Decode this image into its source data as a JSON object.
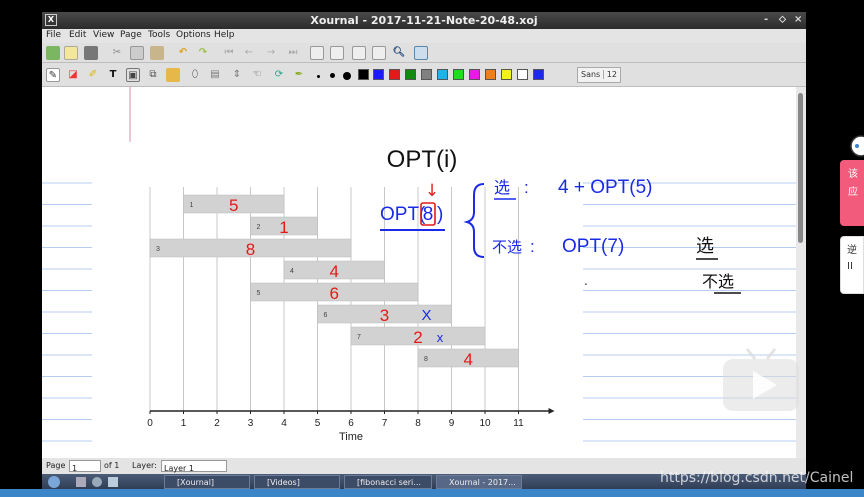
{
  "window": {
    "title": "Xournal - 2017-11-21-Note-20-48.xoj",
    "controls": [
      "-",
      "⬦",
      "×"
    ]
  },
  "menu": [
    "File",
    "Edit",
    "View",
    "Page",
    "Tools",
    "Options",
    "Help"
  ],
  "toolbar": {
    "font_name": "Sans",
    "font_size": "12",
    "colors": [
      "#1a1aff",
      "#e21a1a",
      "#108b10",
      "#808080",
      "#1ab4e8",
      "#1adf1a",
      "#e81ae8",
      "#f07f1a",
      "#f2f21a",
      "#ffffff",
      "#1a2ae8"
    ]
  },
  "note": {
    "heading": "OPT(i)",
    "opt_call": "OPT(",
    "opt_circled": "8",
    "opt_close": ")",
    "branch_select_label": "选",
    "branch_select_expr": "4 + OPT(5)",
    "branch_skip_label": "不选",
    "branch_skip_expr": "OPT(7)",
    "right_word1": "选",
    "right_word2": "不选",
    "colon": ":",
    "arrow": "↓",
    "dot": "."
  },
  "chart_data": {
    "type": "bar",
    "xlabel": "Time",
    "xticks": [
      0,
      1,
      2,
      3,
      4,
      5,
      6,
      7,
      8,
      9,
      10,
      11
    ],
    "xlim": [
      0,
      11
    ],
    "intervals": [
      {
        "index": "1",
        "start": 1,
        "end": 4,
        "value": "5",
        "mark": ""
      },
      {
        "index": "2",
        "start": 3,
        "end": 5,
        "value": "1",
        "mark": ""
      },
      {
        "index": "3",
        "start": 0,
        "end": 6,
        "value": "8",
        "mark": ""
      },
      {
        "index": "4",
        "start": 4,
        "end": 7,
        "value": "4",
        "mark": ""
      },
      {
        "index": "5",
        "start": 3,
        "end": 8,
        "value": "6",
        "mark": ""
      },
      {
        "index": "6",
        "start": 5,
        "end": 9,
        "value": "3",
        "mark": "X"
      },
      {
        "index": "7",
        "start": 6,
        "end": 10,
        "value": "2",
        "mark": "x"
      },
      {
        "index": "8",
        "start": 8,
        "end": 11,
        "value": "4",
        "mark": ""
      }
    ]
  },
  "status": {
    "page_label": "Page",
    "page_value": "1",
    "of_label": "of 1",
    "layer_label": "Layer:",
    "layer_value": "Layer 1"
  },
  "taskbar": {
    "tasks": [
      "[Xournal]",
      "[Videos]",
      "[fibonacci seri...",
      "Xournal - 2017..."
    ]
  },
  "side": {
    "widget1": "该应",
    "widget2": "逆 II"
  },
  "watermark": "https://blog.csdn.net/Cainel"
}
